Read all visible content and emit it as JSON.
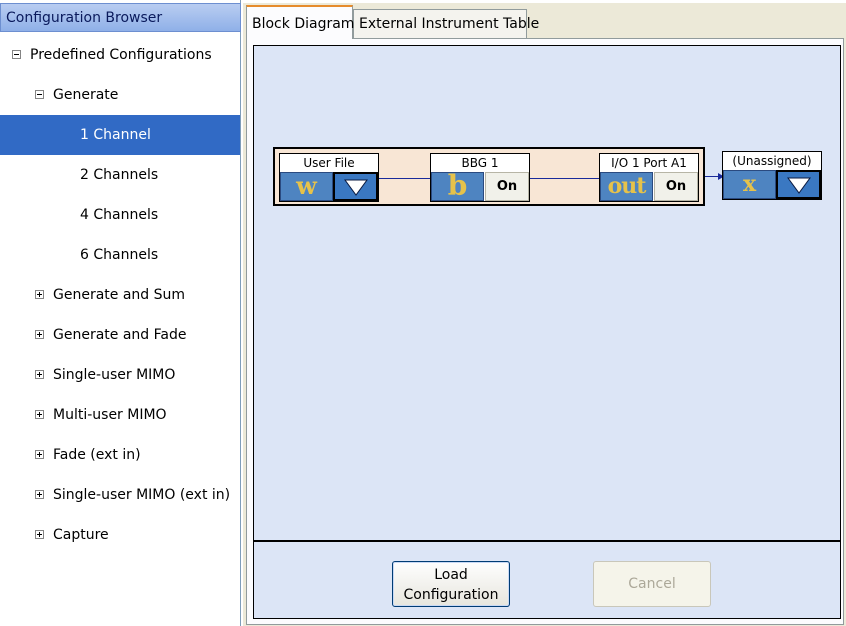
{
  "left_panel": {
    "title": "Configuration Browser",
    "tree": [
      {
        "label": "Predefined Configurations",
        "level": 0,
        "expander": "minus"
      },
      {
        "label": "Generate",
        "level": 1,
        "expander": "minus"
      },
      {
        "label": "1 Channel",
        "level": 2,
        "expander": "none",
        "selected": true
      },
      {
        "label": "2 Channels",
        "level": 2,
        "expander": "none"
      },
      {
        "label": "4 Channels",
        "level": 2,
        "expander": "none"
      },
      {
        "label": "6 Channels",
        "level": 2,
        "expander": "none"
      },
      {
        "label": "Generate and Sum",
        "level": 1,
        "expander": "plus"
      },
      {
        "label": "Generate and Fade",
        "level": 1,
        "expander": "plus"
      },
      {
        "label": "Single-user MIMO",
        "level": 1,
        "expander": "plus"
      },
      {
        "label": "Multi-user MIMO",
        "level": 1,
        "expander": "plus"
      },
      {
        "label": "Fade (ext in)",
        "level": 1,
        "expander": "plus"
      },
      {
        "label": "Single-user MIMO (ext in)",
        "level": 1,
        "expander": "plus"
      },
      {
        "label": "Capture",
        "level": 1,
        "expander": "plus"
      }
    ]
  },
  "tabs": {
    "block_diagram": "Block Diagram",
    "external_instrument_table": "External Instrument Table",
    "active": "Block Diagram"
  },
  "diagram": {
    "user_file": {
      "title": "User File",
      "glyph": "w"
    },
    "bbg": {
      "title": "BBG 1",
      "glyph": "b",
      "state": "On"
    },
    "io_port": {
      "title": "I/O 1 Port A1",
      "glyph": "out",
      "state": "On"
    },
    "unassigned": {
      "title": "(Unassigned)",
      "glyph": "x"
    }
  },
  "buttons": {
    "load_line1": "Load",
    "load_line2": "Configuration",
    "cancel": "Cancel"
  },
  "colors": {
    "selection": "#316ac5",
    "diagram_background": "#dce5f6",
    "chain_background": "#f8e6d5",
    "block_icon": "#4e84c1",
    "glyph_text": "#e6c24a"
  }
}
